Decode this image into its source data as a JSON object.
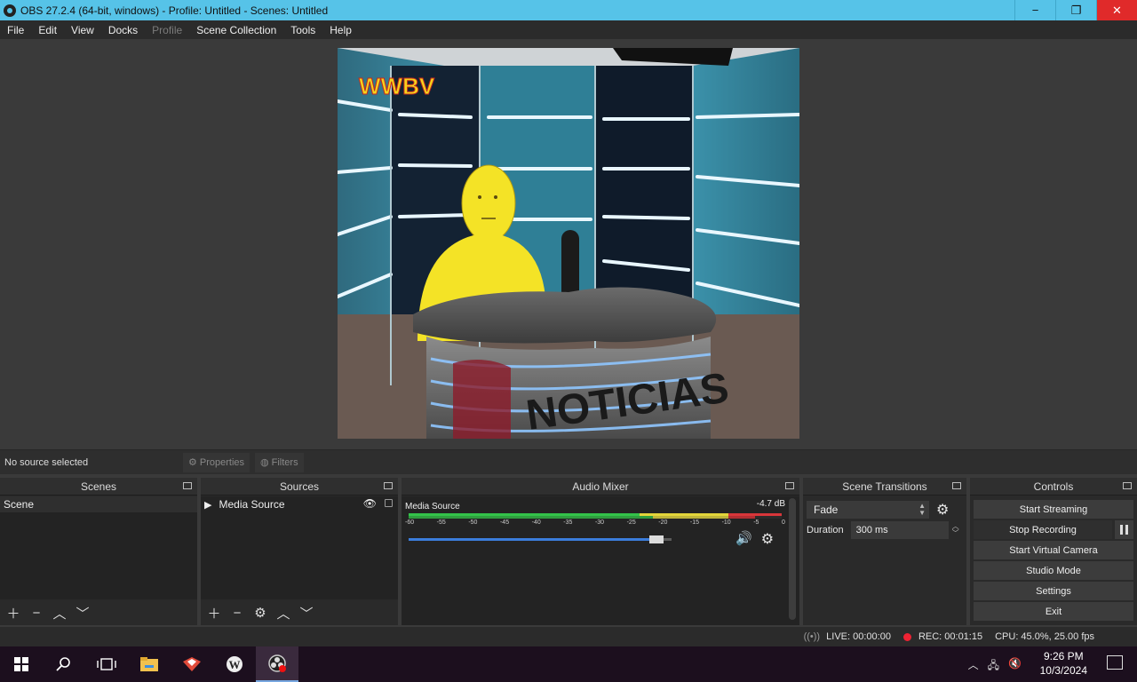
{
  "window": {
    "title": "OBS 27.2.4 (64-bit, windows) - Profile: Untitled - Scenes: Untitled",
    "minimize": "−",
    "restore": "❐",
    "close": "✕"
  },
  "menu": {
    "items": [
      "File",
      "Edit",
      "View",
      "Docks",
      "Profile",
      "Scene Collection",
      "Tools",
      "Help"
    ]
  },
  "preview": {
    "logo_text": "WWBV",
    "desk_text": "NOTICIAS"
  },
  "source_toolbar": {
    "status": "No source selected",
    "properties_label": "Properties",
    "filters_label": "Filters"
  },
  "scenes": {
    "title": "Scenes",
    "items": [
      "Scene"
    ]
  },
  "sources": {
    "title": "Sources",
    "items": [
      "Media Source"
    ]
  },
  "audio_mixer": {
    "title": "Audio Mixer",
    "channel_name": "Media Source",
    "channel_db": "-4.7 dB",
    "tick_labels": [
      "-60",
      "-55",
      "-50",
      "-45",
      "-40",
      "-35",
      "-30",
      "-25",
      "-20",
      "-15",
      "-10",
      "-5",
      "0"
    ],
    "volume_level": 0.97
  },
  "scene_transitions": {
    "title": "Scene Transitions",
    "transition": "Fade",
    "duration_label": "Duration",
    "duration_value": "300 ms"
  },
  "controls": {
    "title": "Controls",
    "buttons": [
      "Start Streaming",
      "Stop Recording",
      "Start Virtual Camera",
      "Studio Mode",
      "Settings",
      "Exit"
    ]
  },
  "status": {
    "live": "LIVE: 00:00:00",
    "rec": "REC: 00:01:15",
    "cpu": "CPU: 45.0%, 25.00 fps"
  },
  "taskbar": {
    "time": "9:26 PM",
    "date": "10/3/2024"
  },
  "colors": {
    "accent_titlebar": "#56c3e8",
    "close_red": "#e02a2a",
    "meter_green": "#33c34a",
    "meter_yellow": "#e3d53a",
    "meter_red": "#d8363a",
    "volume_blue": "#3b7ddc"
  }
}
